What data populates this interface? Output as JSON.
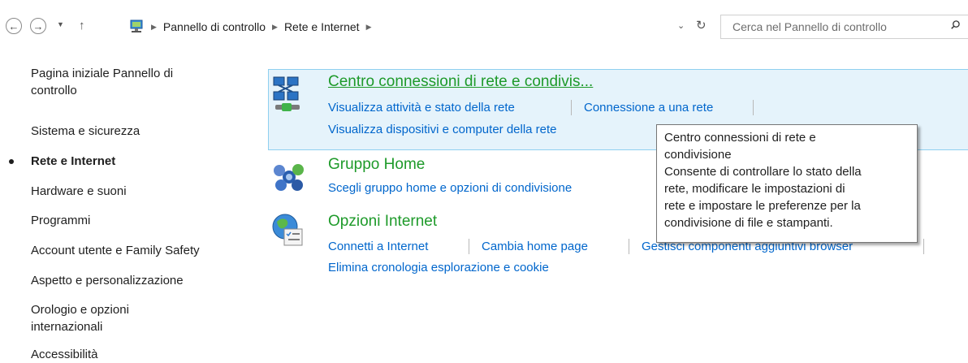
{
  "nav": {
    "back_icon": "back-arrow-icon",
    "forward_icon": "forward-arrow-icon",
    "recent_icon": "chevron-down-icon",
    "up_icon": "up-arrow-icon"
  },
  "address": {
    "crumbs": [
      "Pannello di controllo",
      "Rete e Internet"
    ],
    "dropdown_icon": "chevron-down-icon",
    "refresh_icon": "refresh-icon"
  },
  "search": {
    "placeholder": "Cerca nel Pannello di controllo",
    "icon": "search-icon"
  },
  "sidebar": {
    "home": [
      "Pagina iniziale Pannello di",
      "controllo"
    ],
    "items": [
      "Sistema e sicurezza",
      "Rete e Internet",
      "Hardware e suoni",
      "Programmi",
      "Account utente e Family Safety",
      "Aspetto e personalizzazione",
      "Orologio e opzioni",
      "internazionali",
      "Accessibilità"
    ],
    "current": "Rete e Internet"
  },
  "categories": [
    {
      "title": "Centro connessioni di rete e condivis...",
      "icon": "network-center-icon",
      "tasks": [
        "Visualizza attività e stato della rete",
        "Connessione a una rete",
        "Visualizza dispositivi e computer della rete"
      ]
    },
    {
      "title": "Gruppo Home",
      "icon": "homegroup-icon",
      "tasks": [
        "Scegli gruppo home e opzioni di condivisione"
      ]
    },
    {
      "title": "Opzioni Internet",
      "icon": "internet-options-icon",
      "tasks": [
        "Connetti a Internet",
        "Cambia home page",
        "Gestisci componenti aggiuntivi browser",
        "Elimina cronologia esplorazione e cookie"
      ]
    }
  ],
  "tooltip": {
    "lines": [
      "Centro connessioni di rete e",
      "condivisione",
      "Consente di controllare lo stato della",
      "rete, modificare le impostazioni di",
      "rete e impostare le preferenze per la",
      "condivisione di file e stampanti."
    ]
  },
  "colors": {
    "category_title": "#1e9a2a",
    "link": "#0066cc",
    "highlight_bg": "#e5f3fb",
    "highlight_border": "#8fd0f0"
  }
}
